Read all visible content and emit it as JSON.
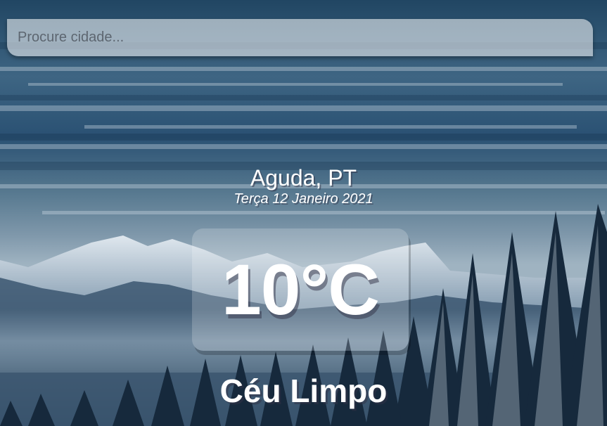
{
  "search": {
    "placeholder": "Procure cidade..."
  },
  "location": {
    "name": "Aguda, PT",
    "date": "Terça 12 Janeiro 2021"
  },
  "weather": {
    "temperature": "10°C",
    "description": "Céu Limpo"
  },
  "background": {
    "scene": "winter-mountains-forest",
    "colors": {
      "sky_top": "#1e4263",
      "sky_mid": "#4e6f8e",
      "horizon": "#a9b9c6",
      "mountain": "#2c4258",
      "snow": "#c7d4df",
      "forest": "#16273a"
    }
  }
}
